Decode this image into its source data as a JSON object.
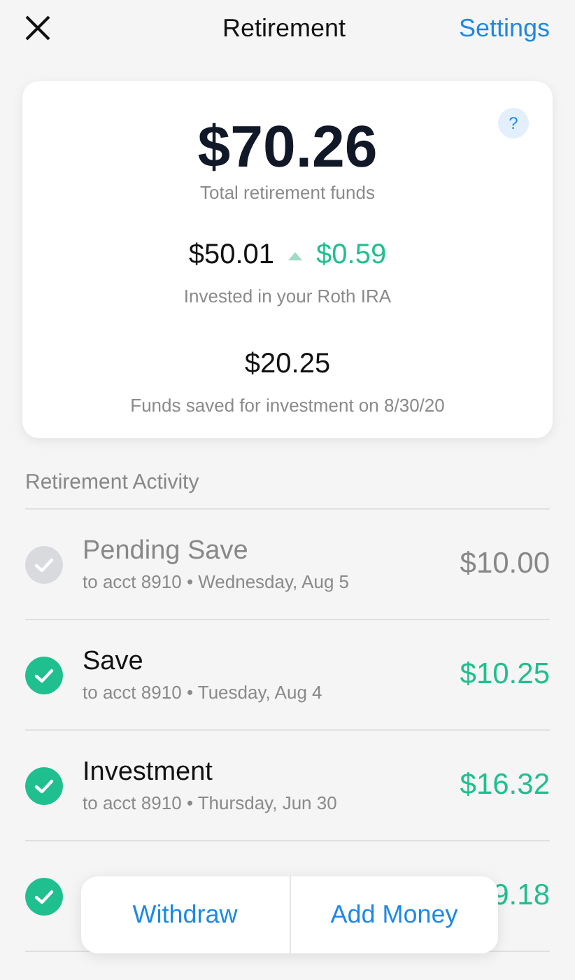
{
  "header": {
    "title": "Retirement",
    "settings": "Settings"
  },
  "summary": {
    "help": "?",
    "total": "$70.26",
    "total_label": "Total retirement funds",
    "invested": "$50.01",
    "change": "$0.59",
    "invested_label": "Invested in your Roth IRA",
    "saved": "$20.25",
    "saved_label": "Funds saved for investment on 8/30/20"
  },
  "activity": {
    "heading": "Retirement Activity",
    "items": [
      {
        "pending": true,
        "title": "Pending Save",
        "subtitle": "to acct 8910 • Wednesday, Aug 5",
        "amount": "$10.00"
      },
      {
        "pending": false,
        "title": "Save",
        "subtitle": "to acct 8910 • Tuesday, Aug 4",
        "amount": "$10.25"
      },
      {
        "pending": false,
        "title": "Investment",
        "subtitle": "to acct 8910 • Thursday, Jun 30",
        "amount": "$16.32"
      },
      {
        "pending": false,
        "amount": "9.18"
      }
    ]
  },
  "actions": [
    "Withdraw",
    "Add Money"
  ]
}
